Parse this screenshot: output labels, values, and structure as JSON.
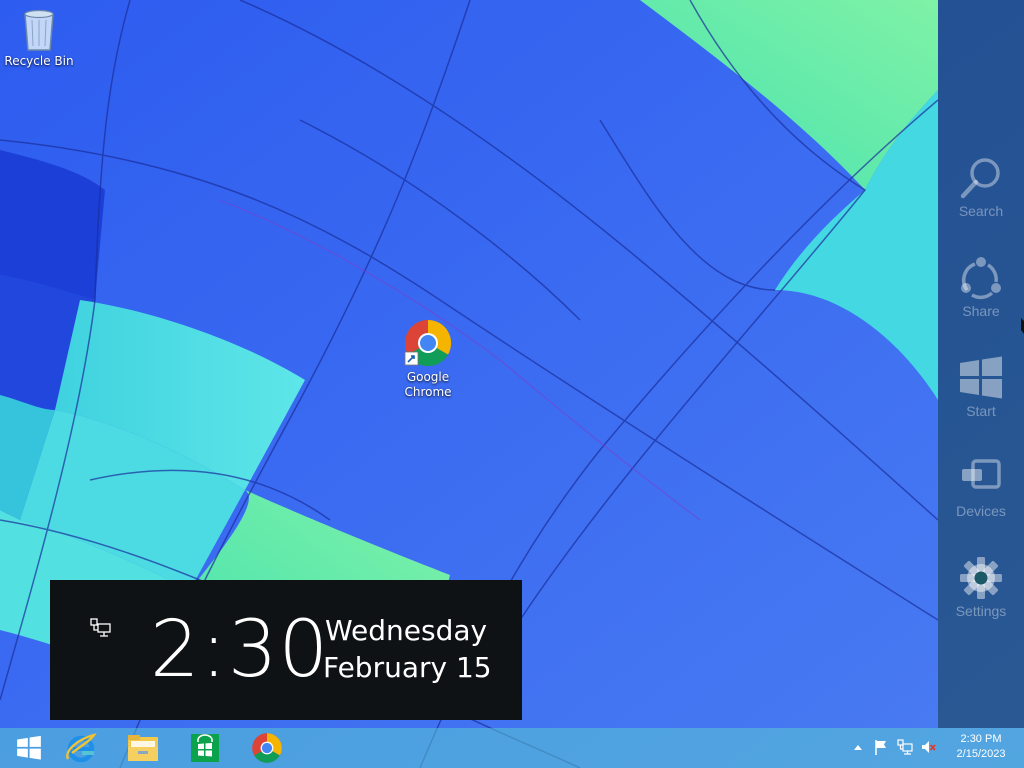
{
  "desktop": {
    "icons": [
      {
        "label": "Recycle Bin",
        "icon": "recycle-bin-icon"
      },
      {
        "label": "Google\nChrome",
        "icon": "chrome-icon"
      }
    ]
  },
  "charms": [
    {
      "label": "Search",
      "icon": "search-icon"
    },
    {
      "label": "Share",
      "icon": "share-icon"
    },
    {
      "label": "Start",
      "icon": "windows-logo-icon"
    },
    {
      "label": "Devices",
      "icon": "devices-icon"
    },
    {
      "label": "Settings",
      "icon": "gear-icon"
    }
  ],
  "clock_overlay": {
    "time": "2:30",
    "day": "Wednesday",
    "date": "February 15",
    "network_icon": "network-icon"
  },
  "taskbar": {
    "pinned": [
      {
        "name": "Start",
        "icon": "windows-logo-icon"
      },
      {
        "name": "Internet Explorer",
        "icon": "internet-explorer-icon"
      },
      {
        "name": "File Explorer",
        "icon": "folder-icon"
      },
      {
        "name": "Store",
        "icon": "store-icon"
      },
      {
        "name": "Google Chrome",
        "icon": "chrome-icon"
      }
    ],
    "tray": {
      "icons": [
        "show-hidden-icons-arrow",
        "action-center-flag-icon",
        "network-icon",
        "volume-muted-icon"
      ],
      "time": "2:30 PM",
      "date": "2/15/2023"
    }
  },
  "colors": {
    "wallpaper_blue": "#3a6ef0",
    "wallpaper_cyan": "#45d8e0",
    "wallpaper_green": "#5ff0a8",
    "charms_bg": "#103c46",
    "clock_bg": "#0f1214",
    "taskbar_bg": "#5ac8d2"
  }
}
